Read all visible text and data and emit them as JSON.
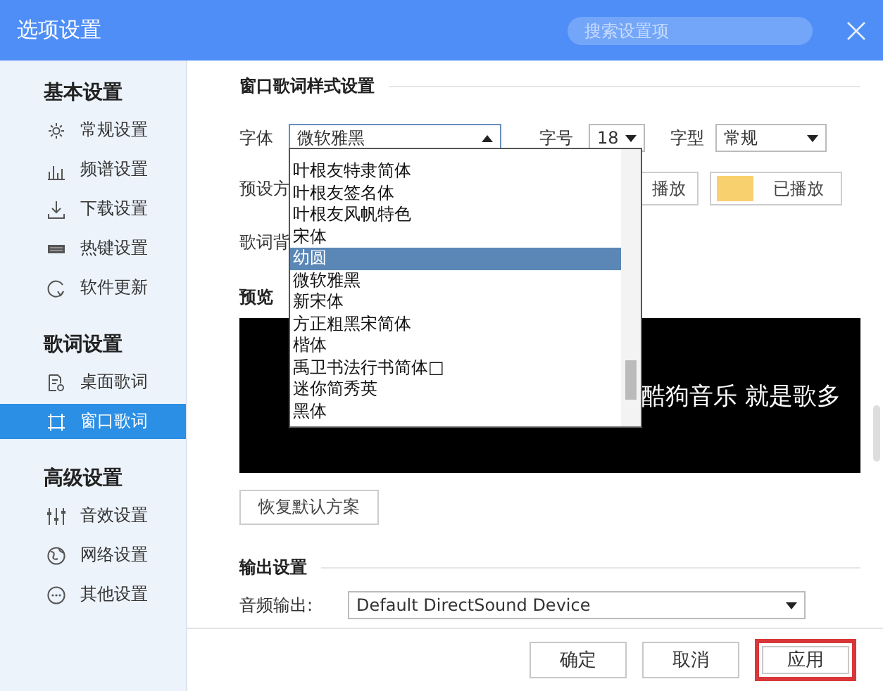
{
  "window": {
    "title": "选项设置",
    "search": {
      "placeholder": "搜索设置项"
    }
  },
  "sidebar": {
    "groups": [
      {
        "title": "基本设置",
        "items": [
          {
            "label": "常规设置",
            "selected": false
          },
          {
            "label": "频谱设置",
            "selected": false
          },
          {
            "label": "下载设置",
            "selected": false
          },
          {
            "label": "热键设置",
            "selected": false
          },
          {
            "label": "软件更新",
            "selected": false
          }
        ]
      },
      {
        "title": "歌词设置",
        "items": [
          {
            "label": "桌面歌词",
            "selected": false
          },
          {
            "label": "窗口歌词",
            "selected": true
          }
        ]
      },
      {
        "title": "高级设置",
        "items": [
          {
            "label": "音效设置",
            "selected": false
          },
          {
            "label": "网络设置",
            "selected": false
          },
          {
            "label": "其他设置",
            "selected": false
          }
        ]
      }
    ]
  },
  "style_section": {
    "title": "窗口歌词样式设置",
    "font": {
      "label": "字体",
      "value": "微软雅黑",
      "expanded": true
    },
    "size": {
      "label": "字号",
      "value": "18"
    },
    "weight": {
      "label": "字型",
      "value": "常规"
    },
    "preset_label": "预设方",
    "unplayed_button": "播放",
    "played_button": {
      "label": "已播放",
      "color": "#f9d06e"
    },
    "background_label": "歌词背",
    "preview": {
      "label": "预览",
      "text": "酷狗音乐 就是歌多"
    },
    "reset_button": "恢复默认方案"
  },
  "font_list": {
    "items": [
      {
        "label": "叶根友特隶简体",
        "selected": false
      },
      {
        "label": "叶根友签名体",
        "selected": false
      },
      {
        "label": "叶根友风帆特色",
        "selected": false
      },
      {
        "label": "宋体",
        "selected": false
      },
      {
        "label": "幼圆",
        "selected": true
      },
      {
        "label": "微软雅黑",
        "selected": false
      },
      {
        "label": "新宋体",
        "selected": false
      },
      {
        "label": "方正粗黑宋简体",
        "selected": false
      },
      {
        "label": "楷体",
        "selected": false
      },
      {
        "label": "禹卫书法行书简体□",
        "selected": false
      },
      {
        "label": "迷你简秀英",
        "selected": false
      },
      {
        "label": "黑体",
        "selected": false
      }
    ]
  },
  "output_section": {
    "title": "输出设置",
    "audio_label": "音频输出:",
    "audio_device": "Default DirectSound Device"
  },
  "footer": {
    "buttons": [
      {
        "label": "确定",
        "highlighted": false
      },
      {
        "label": "取消",
        "highlighted": false
      },
      {
        "label": "应用",
        "highlighted": true
      }
    ]
  }
}
